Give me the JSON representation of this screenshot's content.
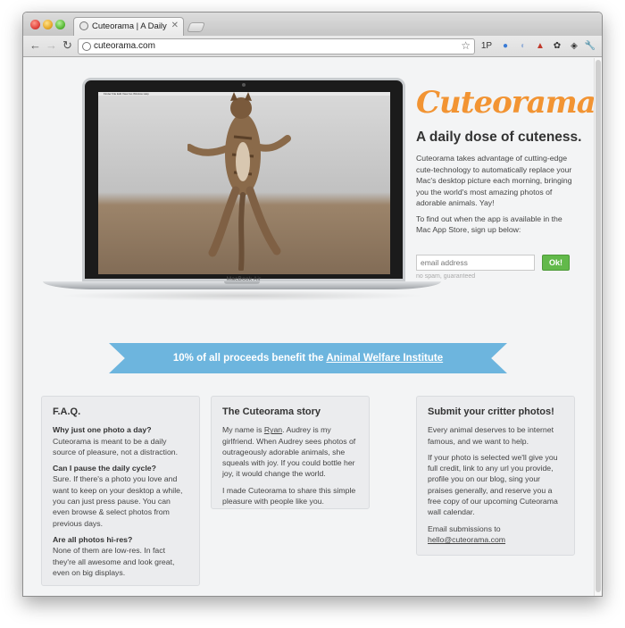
{
  "browser": {
    "tab_title": "Cuteorama | A Daily Dose of Cuteness",
    "tab_close": "✕",
    "url": "cuteorama.com",
    "nav": {
      "back": "←",
      "forward": "→",
      "reload": "↻"
    },
    "star": "☆",
    "extensions": [
      "1P",
      "●",
      "◐",
      "▲",
      "✿",
      "◈",
      "⇆",
      "🔧"
    ]
  },
  "laptop": {
    "brand_label": "MacBook Air",
    "menubar_text": " Finder  File  Edit  View  Go  Window  Help"
  },
  "hero": {
    "logo": "Cuteorama",
    "tagline": "A daily dose of cuteness.",
    "paragraph1": "Cuteorama takes advantage of cutting-edge cute-technology to automatically replace your Mac's desktop picture each morning, bringing you the world's most amazing photos of adorable animals. Yay!",
    "paragraph2": "To find out when the app is available in the Mac App Store, sign up below:",
    "email_placeholder": "email address",
    "ok_label": "Ok!",
    "no_spam": "no spam, guaranteed"
  },
  "ribbon": {
    "prefix": "10% of all proceeds benefit the ",
    "link_text": "Animal Welfare Institute"
  },
  "faq": {
    "title": "F.A.Q.",
    "items": [
      {
        "q": "Why just one photo a day?",
        "a": "Cuteorama is meant to be a daily source of pleasure, not a distraction."
      },
      {
        "q": "Can I pause the daily cycle?",
        "a": "Sure. If there's a photo you love and want to keep on your desktop a while, you can just press pause. You can even browse & select photos from previous days."
      },
      {
        "q": "Are all photos hi-res?",
        "a": "None of them are low-res. In fact they're all awesome and look great, even on big displays."
      }
    ]
  },
  "story": {
    "title": "The Cuteorama story",
    "p1_before": "My name is ",
    "p1_link": "Ryan",
    "p1_after": ". Audrey is my girlfriend. When Audrey sees photos of outrageously adorable animals, she squeals with joy. If you could bottle her joy, it would change the world.",
    "p2": "I made Cuteorama to share this simple pleasure with people like you."
  },
  "submit": {
    "title": "Submit your critter photos!",
    "p1": "Every animal deserves to be internet famous, and we want to help.",
    "p2": "If your photo is selected we'll give you full credit, link to any url you provide, profile you on our blog, sing your praises generally, and reserve you a free copy of our upcoming Cuteorama wall calendar.",
    "p3": "Email submissions to",
    "email": "hello@cuteorama.com"
  }
}
